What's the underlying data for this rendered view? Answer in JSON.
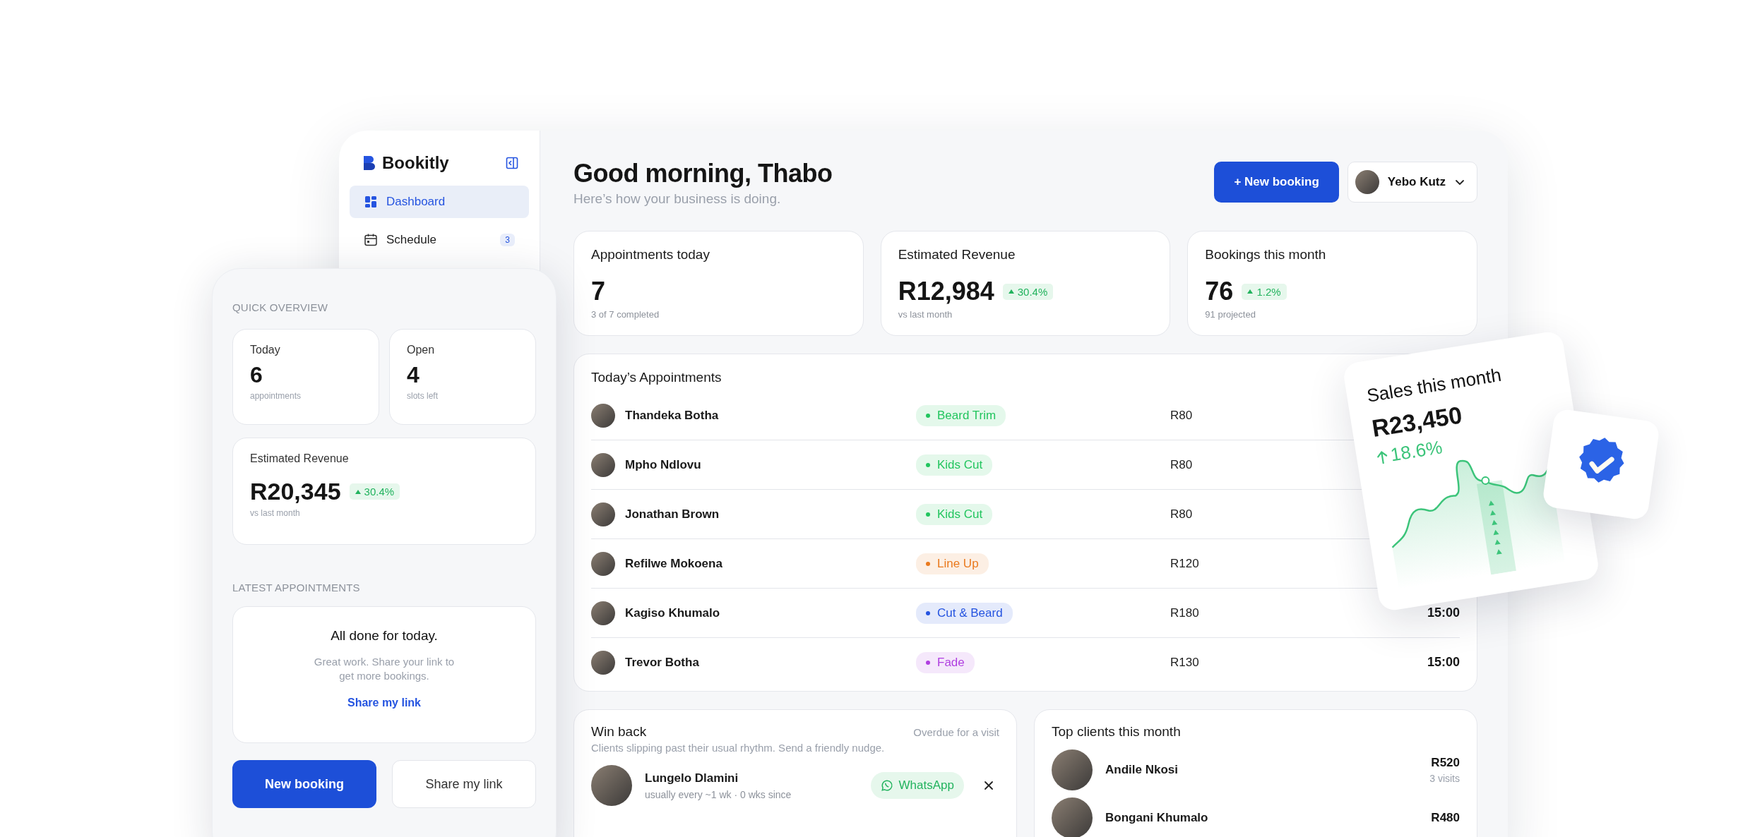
{
  "sidebar": {
    "brand": "Bookitly",
    "items": [
      {
        "label": "Dashboard",
        "selected": true
      },
      {
        "label": "Schedule",
        "selected": false,
        "count": "3"
      }
    ]
  },
  "header": {
    "title": "Good morning, Thabo",
    "subtitle": "Here’s how your business is doing.",
    "new_booking": "+ New booking",
    "user": "Yebo Kutz"
  },
  "stats": [
    {
      "label": "Appointments today",
      "value": "7",
      "note": "3 of 7 completed"
    },
    {
      "label": "Estimated Revenue",
      "value": "R12,984",
      "change": "30.4%",
      "note": "vs last month"
    },
    {
      "label": "Bookings this month",
      "value": "76",
      "change": "1.2%",
      "note": "91 projected"
    }
  ],
  "appointments": {
    "title": "Today’s Appointments",
    "rows": [
      {
        "name": "Thandeka Botha",
        "service": "Beard Trim",
        "color": "#22c55e",
        "price": "R80"
      },
      {
        "name": "Mpho Ndlovu",
        "service": "Kids Cut",
        "color": "#22c55e",
        "price": "R80"
      },
      {
        "name": "Jonathan Brown",
        "service": "Kids Cut",
        "color": "#22c55e",
        "price": "R80"
      },
      {
        "name": "Refilwe Mokoena",
        "service": "Line Up",
        "color": "#ea7a1e",
        "price": "R120"
      },
      {
        "name": "Kagiso Khumalo",
        "service": "Cut & Beard",
        "color": "#2554e0",
        "price": "R180",
        "time": "15:00"
      },
      {
        "name": "Trevor Botha",
        "service": "Fade",
        "color": "#b03fe0",
        "price": "R130",
        "time": "15:00"
      }
    ]
  },
  "win_back": {
    "title": "Win back",
    "tag": "Overdue for a visit",
    "subtitle": "Clients slipping past their usual rhythm. Send a friendly nudge.",
    "clients": [
      {
        "name": "Lungelo Dlamini",
        "note": "usually every ~1 wk · 0 wks since",
        "action": "WhatsApp"
      }
    ]
  },
  "top_clients": {
    "title": "Top clients this month",
    "clients": [
      {
        "name": "Andile Nkosi",
        "amount": "R520",
        "visits": "3 visits"
      },
      {
        "name": "Bongani Khumalo",
        "amount": "R480"
      }
    ]
  },
  "quick_overview": {
    "title": "QUICK OVERVIEW",
    "cards": [
      {
        "label": "Today",
        "value": "6",
        "note": "appointments"
      },
      {
        "label": "Open",
        "value": "4",
        "note": "slots left"
      }
    ],
    "revenue": {
      "label": "Estimated Revenue",
      "value": "R20,345",
      "change": "30.4%",
      "note": "vs last month"
    },
    "latest_title": "LATEST APPOINTMENTS",
    "empty": {
      "title": "All done for today.",
      "text": "Great work. Share your link to get more bookings.",
      "link": "Share my link"
    },
    "buttons": [
      {
        "label": "New booking",
        "kind": "primary"
      },
      {
        "label": "Share my link",
        "kind": "secondary"
      }
    ]
  },
  "sales_card": {
    "title": "Sales this month",
    "value": "R23,450",
    "change": "18.6%"
  }
}
